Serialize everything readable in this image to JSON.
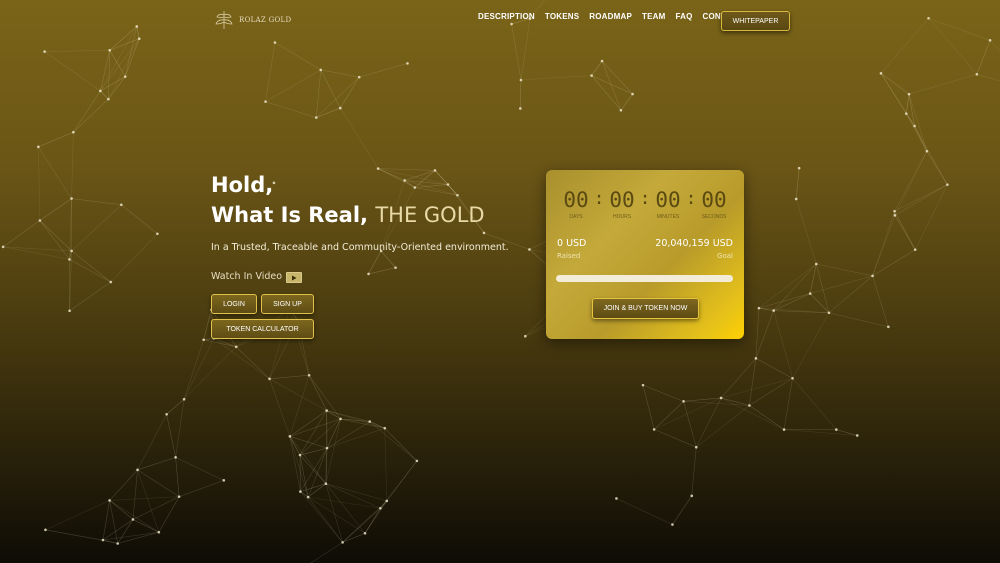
{
  "header": {
    "logo_text": "ROLAZ GOLD",
    "nav": [
      "DESCRIPTION",
      "TOKENS",
      "ROADMAP",
      "TEAM",
      "FAQ",
      "CONTACT"
    ],
    "whitepaper_label": "WHITEPAPER"
  },
  "hero": {
    "line1": "Hold,",
    "line2_prefix": "What Is Real, ",
    "line2_highlight": "THE GOLD",
    "subtitle": "In a Trusted, Traceable and Community-Oriented environment.",
    "watch_label": "Watch In Video",
    "login_label": "LOGIN",
    "signup_label": "SIGN UP",
    "calculator_label": "TOKEN CALCULATOR"
  },
  "sale_card": {
    "countdown": [
      {
        "value": "00",
        "label": "DAYS"
      },
      {
        "value": "00",
        "label": "HOURS"
      },
      {
        "value": "00",
        "label": "MINUTES"
      },
      {
        "value": "00",
        "label": "SECONDS"
      }
    ],
    "raised_value": "0 USD",
    "raised_label": "Raised",
    "goal_value": "20,040,159 USD",
    "goal_label": "Goal",
    "progress_fraction": 0,
    "join_label": "JOIN & BUY TOKEN NOW"
  },
  "colors": {
    "accent_gold": "#e6c21a",
    "button_border": "#e0c14c",
    "highlight_text": "#e8d9a6"
  }
}
